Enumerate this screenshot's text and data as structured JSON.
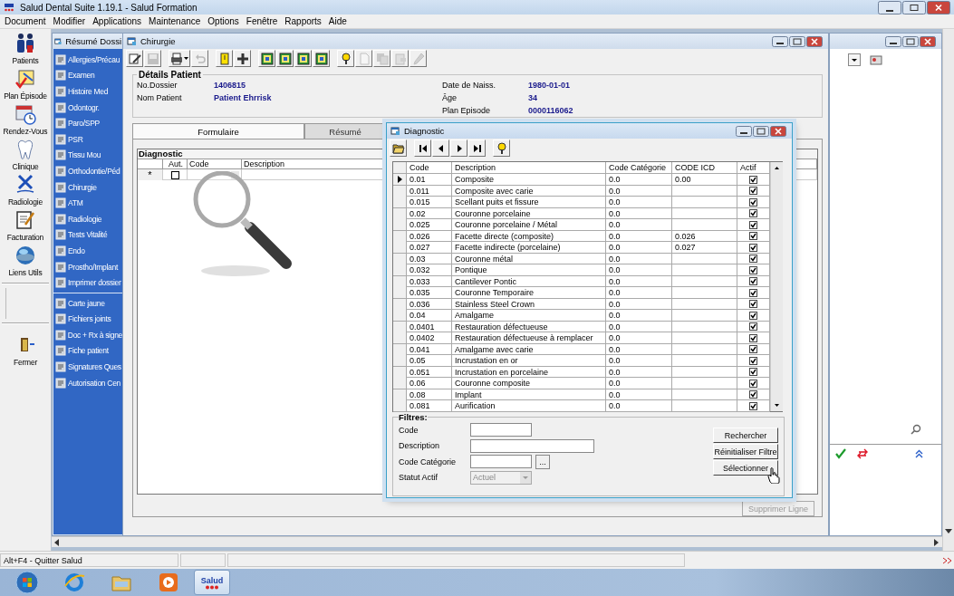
{
  "app": {
    "title": "Salud Dental Suite 1.19.1 - Salud Formation"
  },
  "menu": [
    "Document",
    "Modifier",
    "Applications",
    "Maintenance",
    "Options",
    "Fenêtre",
    "Rapports",
    "Aide"
  ],
  "nav": [
    {
      "label": "Patients",
      "kind": "patients"
    },
    {
      "label": "Plan Épisode",
      "kind": "plan"
    },
    {
      "label": "Rendez-Vous",
      "kind": "calendar"
    },
    {
      "label": "Clinique",
      "kind": "tooth"
    },
    {
      "label": "Radiologie",
      "kind": "xray"
    },
    {
      "label": "Facturation",
      "kind": "billing"
    },
    {
      "label": "Liens Utils",
      "kind": "globe"
    },
    {
      "label": "Fermer",
      "kind": "exit"
    }
  ],
  "resume_window": {
    "title": "Résumé Dossi",
    "sections": [
      {
        "items": [
          "Allergies/Précau",
          "Examen",
          "Histoire Med",
          "Odontogr.",
          "Paro/SPP",
          "PSR",
          "Tissu Mou",
          "Orthodontie/Péd",
          "Chirurgie",
          "ATM",
          "Radiologie",
          "Tests Vitalité",
          "Endo",
          "Prostho/Implant",
          "Imprimer dossier"
        ]
      },
      {
        "items": [
          "Carte jaune",
          "Fichiers joints",
          "Doc + Rx à signe",
          "Fiche patient",
          "Signatures Ques",
          "Autorisation Cen"
        ]
      }
    ]
  },
  "chirurgie": {
    "title": "Chirurgie",
    "toolbar": [
      {
        "kind": "edit",
        "disabled": false
      },
      {
        "kind": "save",
        "disabled": true
      },
      {
        "kind": "print",
        "disabled": false
      },
      {
        "kind": "undo",
        "disabled": true
      },
      {
        "kind": "note",
        "disabled": false
      },
      {
        "kind": "plus",
        "disabled": false
      },
      {
        "kind": "image",
        "disabled": false
      },
      {
        "kind": "image",
        "disabled": false
      },
      {
        "kind": "image",
        "disabled": false
      },
      {
        "kind": "image",
        "disabled": false
      },
      {
        "kind": "help",
        "disabled": false
      },
      {
        "kind": "page",
        "disabled": true
      },
      {
        "kind": "copy",
        "disabled": true
      },
      {
        "kind": "paste",
        "disabled": true
      },
      {
        "kind": "tool",
        "disabled": true
      }
    ],
    "details": {
      "title": "Détails Patient",
      "left": [
        {
          "label": "No.Dossier",
          "value": "1406815"
        },
        {
          "label": "Nom Patient",
          "value": "Patient Ehrrisk"
        }
      ],
      "right": [
        {
          "label": "Date de Naiss.",
          "value": "1980-01-01"
        },
        {
          "label": "Âge",
          "value": "34"
        },
        {
          "label": "Plan Episode",
          "value": "0000116062"
        }
      ]
    },
    "tabs": [
      {
        "label": "Formulaire",
        "selected": true
      },
      {
        "label": "Résumé",
        "selected": false
      }
    ],
    "grid": {
      "title": "Diagnostic",
      "columns": [
        "Aut.",
        "Code",
        "Description"
      ],
      "new_row": {
        "marker": "*",
        "checked": false
      }
    },
    "delete_button": {
      "label": "Supprimer Ligne",
      "disabled": true
    }
  },
  "diagnostic_dialog": {
    "title": "Diagnostic",
    "toolbar": [
      {
        "kind": "open"
      },
      {
        "kind": "first"
      },
      {
        "kind": "prev"
      },
      {
        "kind": "next"
      },
      {
        "kind": "last"
      },
      {
        "kind": "help"
      }
    ],
    "columns": [
      "Code",
      "Description",
      "Code Catégorie",
      "CODE ICD",
      "Actif"
    ],
    "rows": [
      {
        "code": "0.01",
        "description": "Composite",
        "category": "0.0",
        "icd": "0.00",
        "active": true,
        "selected": true
      },
      {
        "code": "0.011",
        "description": "Composite avec carie",
        "category": "0.0",
        "active": true,
        "selected": false
      },
      {
        "code": "0.015",
        "description": "Scellant puits et fissure",
        "category": "0.0",
        "active": true,
        "selected": false
      },
      {
        "code": "0.02",
        "description": "Couronne porcelaine",
        "category": "0.0",
        "active": true,
        "selected": false
      },
      {
        "code": "0.025",
        "description": "Couronne porcelaine / Métal",
        "category": "0.0",
        "active": true,
        "selected": false
      },
      {
        "code": "0.026",
        "description": "Facette directe (composite)",
        "category": "0.0",
        "icd": "0.026",
        "active": true,
        "selected": false
      },
      {
        "code": "0.027",
        "description": "Facette indirecte (porcelaine)",
        "category": "0.0",
        "icd": "0.027",
        "active": true,
        "selected": false
      },
      {
        "code": "0.03",
        "description": "Couronne métal",
        "category": "0.0",
        "active": true,
        "selected": false
      },
      {
        "code": "0.032",
        "description": "Pontique",
        "category": "0.0",
        "active": true,
        "selected": false
      },
      {
        "code": "0.033",
        "description": "Cantilever Pontic",
        "category": "0.0",
        "active": true,
        "selected": false
      },
      {
        "code": "0.035",
        "description": "Couronne Temporaire",
        "category": "0.0",
        "active": true,
        "selected": false
      },
      {
        "code": "0.036",
        "description": "Stainless Steel Crown",
        "category": "0.0",
        "active": true,
        "selected": false
      },
      {
        "code": "0.04",
        "description": "Amalgame",
        "category": "0.0",
        "active": true,
        "selected": false
      },
      {
        "code": "0.0401",
        "description": "Restauration défectueuse",
        "category": "0.0",
        "active": true,
        "selected": false
      },
      {
        "code": "0.0402",
        "description": "Restauration défectueuse à remplacer",
        "category": "0.0",
        "active": true,
        "selected": false
      },
      {
        "code": "0.041",
        "description": "Amalgame avec carie",
        "category": "0.0",
        "active": true,
        "selected": false
      },
      {
        "code": "0.05",
        "description": "Incrustation en or",
        "category": "0.0",
        "active": true,
        "selected": false
      },
      {
        "code": "0.051",
        "description": "Incrustation en porcelaine",
        "category": "0.0",
        "active": true,
        "selected": false
      },
      {
        "code": "0.06",
        "description": "Couronne composite",
        "category": "0.0",
        "active": true,
        "selected": false
      },
      {
        "code": "0.08",
        "description": "Implant",
        "category": "0.0",
        "active": true,
        "selected": false
      },
      {
        "code": "0.081",
        "description": "Aurification",
        "category": "0.0",
        "active": true,
        "selected": false
      }
    ],
    "filters": {
      "title": "Filtres:",
      "fields": [
        {
          "label": "Code",
          "kind": "text"
        },
        {
          "label": "Description",
          "kind": "wide"
        },
        {
          "label": "Code Catégorie",
          "kind": "lookup",
          "button": "..."
        },
        {
          "label": "Statut Actif",
          "kind": "select",
          "value": "Actuel",
          "disabled": true
        }
      ],
      "buttons": [
        "Rechercher",
        "Réinitialiser Filtre",
        "Sélectionner"
      ]
    }
  },
  "status_bar": {
    "message": "Alt+F4 - Quitter Salud"
  },
  "taskbar": [
    {
      "kind": "start",
      "selected": false
    },
    {
      "kind": "browser",
      "selected": false
    },
    {
      "kind": "folder",
      "selected": false
    },
    {
      "kind": "media",
      "selected": false
    },
    {
      "kind": "salud",
      "label": "Salud",
      "selected": true
    }
  ]
}
